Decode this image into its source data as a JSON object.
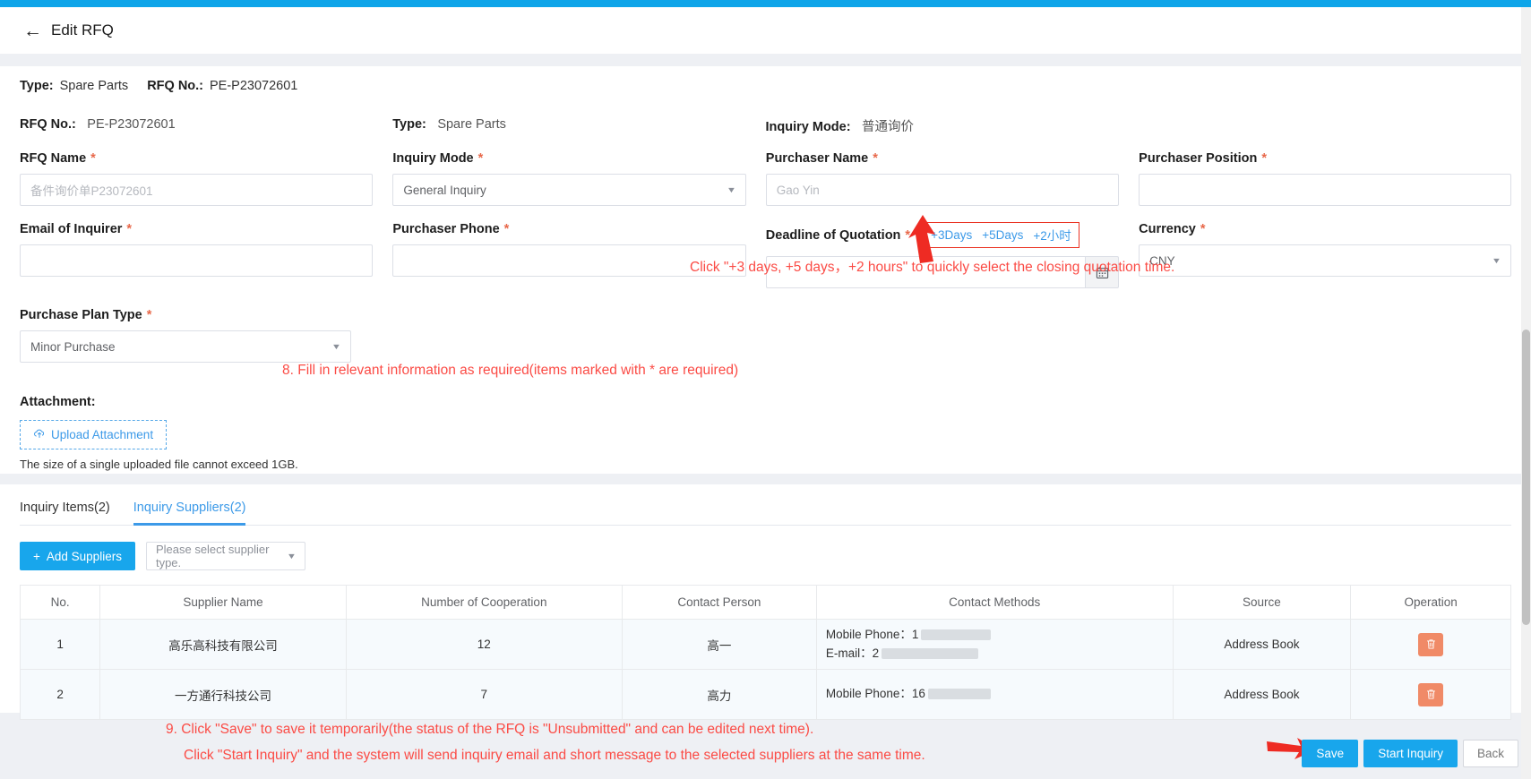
{
  "header": {
    "back_icon": "arrow-left-icon",
    "title": "Edit RFQ"
  },
  "summary": {
    "type_label": "Type:",
    "type_value": "Spare Parts",
    "rfq_no_label": "RFQ No.:",
    "rfq_no_value": "PE-P23072601"
  },
  "form": {
    "static": {
      "rfq_no_label": "RFQ No.:",
      "rfq_no_value": "PE-P23072601",
      "type_label": "Type:",
      "type_value": "Spare Parts",
      "inquiry_mode_label": "Inquiry Mode:",
      "inquiry_mode_value": "普通询价"
    },
    "rfq_name": {
      "label": "RFQ Name",
      "required": "*",
      "value": "备件询价单P23072601"
    },
    "inquiry_mode": {
      "label": "Inquiry Mode",
      "required": "*",
      "value": "General Inquiry"
    },
    "purchaser_name": {
      "label": "Purchaser Name",
      "required": "*",
      "value": "Gao Yin"
    },
    "purchaser_position": {
      "label": "Purchaser Position",
      "required": "*",
      "value": ""
    },
    "email_of_inquirer": {
      "label": "Email of Inquirer",
      "required": "*",
      "value": ""
    },
    "purchaser_phone": {
      "label": "Purchaser Phone",
      "required": "*",
      "value": ""
    },
    "deadline": {
      "label": "Deadline of Quotation",
      "required": "*",
      "value": "",
      "quick_3days": "+3Days",
      "quick_5days": "+5Days",
      "quick_2hours": "+2小时",
      "calendar_icon": "calendar-icon"
    },
    "currency": {
      "label": "Currency",
      "required": "*",
      "value": "CNY"
    },
    "purchase_plan_type": {
      "label": "Purchase Plan Type",
      "required": "*",
      "value": "Minor Purchase"
    },
    "attachment": {
      "label": "Attachment:",
      "upload_button": "Upload Attachment",
      "upload_icon": "cloud-upload-icon",
      "note": "The size of a single uploaded file cannot exceed 1GB."
    }
  },
  "annotations": {
    "quick_time_hint": "Click \"+3 days, +5 days，+2 hours\" to quickly select the closing quotation time.",
    "step8": "8. Fill in relevant information as required(items marked with * are required)",
    "step9_line1": "9. Click \"Save\" to save it temporarily(the status of the RFQ is \"Unsubmitted\" and can be edited next time).",
    "step9_line2": "Click \"Start Inquiry\" and the system will send inquiry email and short message to the selected suppliers at the same time.",
    "color": "#fb4b45"
  },
  "tabs": [
    {
      "label": "Inquiry Items(2)",
      "active": false
    },
    {
      "label": "Inquiry Suppliers(2)",
      "active": true
    }
  ],
  "toolbar": {
    "add_suppliers": "Add  Suppliers",
    "plus_icon": "plus-icon",
    "supplier_type_placeholder": "Please select supplier type."
  },
  "table": {
    "columns": [
      "No.",
      "Supplier Name",
      "Number of Cooperation",
      "Contact Person",
      "Contact Methods",
      "Source",
      "Operation"
    ],
    "rows": [
      {
        "no": "1",
        "supplier_name": "高乐高科技有限公司",
        "cooperation": "12",
        "contact_person": "高一",
        "mobile_label": "Mobile Phone：",
        "mobile_value": "1",
        "email_label": "E-mail：",
        "email_value": "2",
        "source": "Address Book",
        "delete_icon": "trash-icon"
      },
      {
        "no": "2",
        "supplier_name": "一方通行科技公司",
        "cooperation": "7",
        "contact_person": "高力",
        "mobile_label": "Mobile Phone：",
        "mobile_value": "16",
        "email_label": "",
        "email_value": "",
        "source": "Address Book",
        "delete_icon": "trash-icon"
      }
    ]
  },
  "footer": {
    "save": "Save",
    "start_inquiry": "Start Inquiry",
    "back": "Back"
  },
  "colors": {
    "accent": "#18a6ec",
    "top_strip": "#0ea5e9",
    "annotation_red": "#fb4b45",
    "required_star": "#e8684a",
    "delete_btn": "#f08a67"
  }
}
